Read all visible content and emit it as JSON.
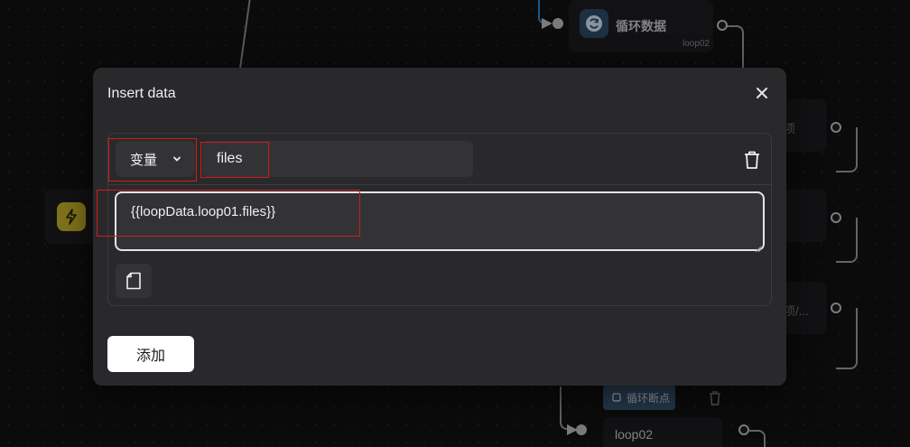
{
  "background": {
    "loop_node_top": {
      "title": "循环数据",
      "tag": "loop02",
      "icon": "refresh-icon"
    },
    "trigger_icon": "lightning-icon",
    "loop_break_node": {
      "label": "循环断点",
      "icon": "square-icon"
    },
    "loop_node_bottom": {
      "tag": "loop02"
    },
    "partial_labels": [
      "项",
      "项/..."
    ]
  },
  "modal": {
    "title": "Insert data",
    "close_icon": "close-icon",
    "row": {
      "type_label": "变量",
      "name_value": "files",
      "value": "{{loopData.loop01.files}}"
    },
    "add_label": "添加"
  },
  "colors": {
    "accent_blue": "#2f86d6",
    "highlight_red": "#d11b1b",
    "trigger_yellow": "#c7b12c"
  }
}
